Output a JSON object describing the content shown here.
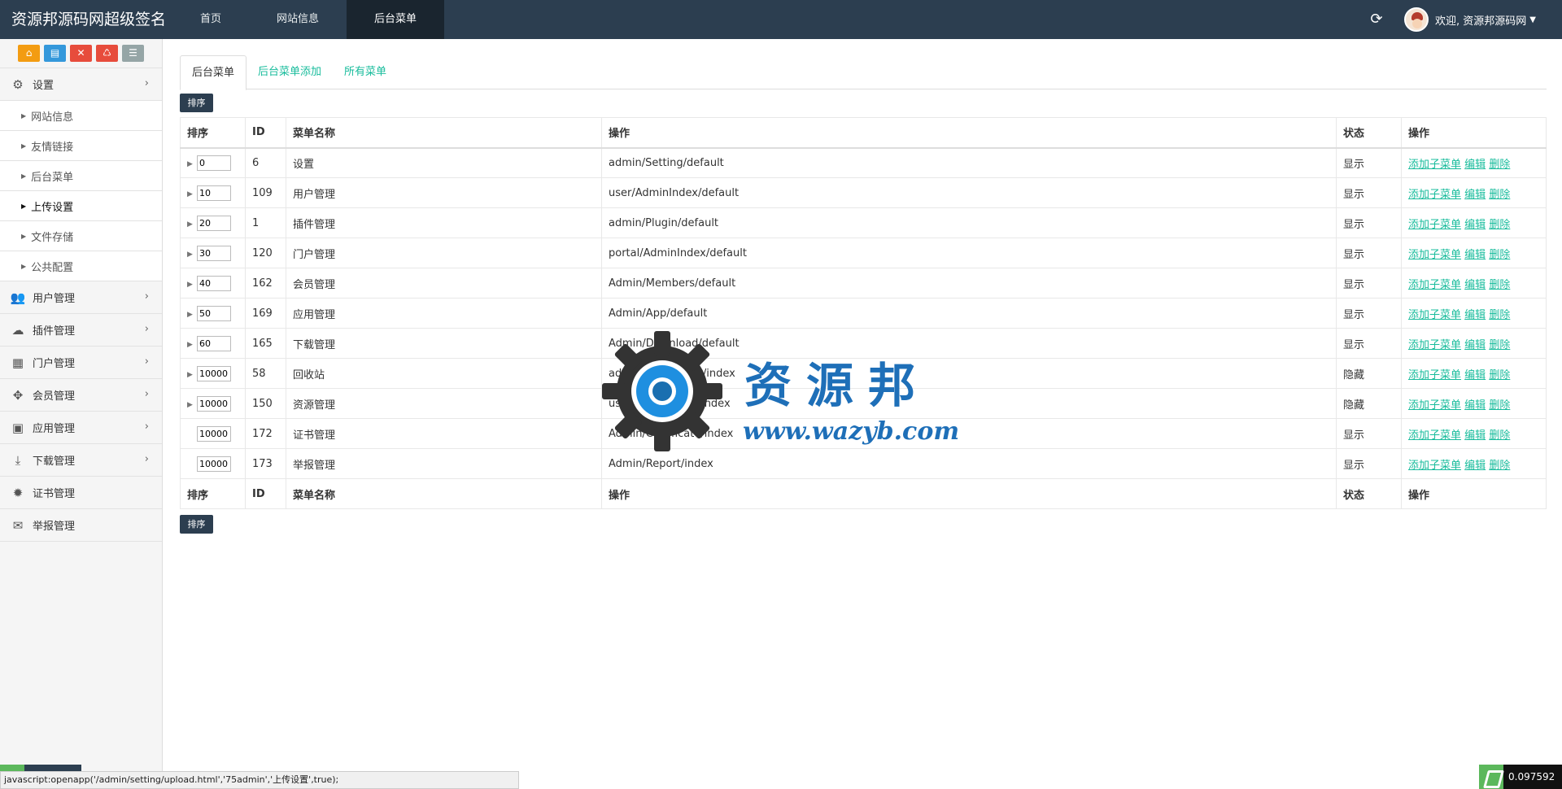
{
  "brand": "资源邦源码网超级签名",
  "nav": [
    "首页",
    "网站信息",
    "后台菜单"
  ],
  "user": {
    "greeting": "欢迎, 资源邦源码网"
  },
  "sidebar": {
    "settings_group": "设置",
    "settings_items": [
      "网站信息",
      "友情链接",
      "后台菜单",
      "上传设置",
      "文件存储",
      "公共配置"
    ],
    "groups": [
      {
        "label": "用户管理",
        "icon": "users-icon"
      },
      {
        "label": "插件管理",
        "icon": "cloud-icon"
      },
      {
        "label": "门户管理",
        "icon": "grid-icon"
      },
      {
        "label": "会员管理",
        "icon": "move-icon"
      },
      {
        "label": "应用管理",
        "icon": "android-icon"
      },
      {
        "label": "下载管理",
        "icon": "download-icon"
      },
      {
        "label": "证书管理",
        "icon": "cog-icon"
      },
      {
        "label": "举报管理",
        "icon": "envelope-icon"
      }
    ]
  },
  "tabs": [
    "后台菜单",
    "后台菜单添加",
    "所有菜单"
  ],
  "sort_button": "排序",
  "table": {
    "headers": [
      "排序",
      "ID",
      "菜单名称",
      "操作",
      "状态",
      "操作"
    ],
    "rows": [
      {
        "sort": "0",
        "id": "6",
        "name": "设置",
        "path": "admin/Setting/default",
        "status": "显示"
      },
      {
        "sort": "10",
        "id": "109",
        "name": "用户管理",
        "path": "user/AdminIndex/default",
        "status": "显示"
      },
      {
        "sort": "20",
        "id": "1",
        "name": "插件管理",
        "path": "admin/Plugin/default",
        "status": "显示"
      },
      {
        "sort": "30",
        "id": "120",
        "name": "门户管理",
        "path": "portal/AdminIndex/default",
        "status": "显示"
      },
      {
        "sort": "40",
        "id": "162",
        "name": "会员管理",
        "path": "Admin/Members/default",
        "status": "显示"
      },
      {
        "sort": "50",
        "id": "169",
        "name": "应用管理",
        "path": "Admin/App/default",
        "status": "显示"
      },
      {
        "sort": "60",
        "id": "165",
        "name": "下载管理",
        "path": "Admin/Download/default",
        "status": "显示"
      },
      {
        "sort": "10000",
        "id": "58",
        "name": "回收站",
        "path": "admin/RecycleBin/index",
        "status": "隐藏"
      },
      {
        "sort": "10000",
        "id": "150",
        "name": "资源管理",
        "path": "user/AdminAsset/index",
        "status": "隐藏"
      },
      {
        "sort": "10000",
        "id": "172",
        "name": "证书管理",
        "path": "Admin/Certificate/index",
        "status": "显示"
      },
      {
        "sort": "10000",
        "id": "173",
        "name": "举报管理",
        "path": "Admin/Report/index",
        "status": "显示"
      }
    ],
    "actions": [
      "添加子菜单",
      "编辑",
      "删除"
    ]
  },
  "watermark": {
    "cn": "资源邦",
    "url": "www.wazyb.com"
  },
  "statusbar": "javascript:openapp('/admin/setting/upload.html','75admin','上传设置',true);",
  "speed": "0.097592",
  "colors": {
    "navbar": "#2c3e50",
    "accent": "#18bc9c",
    "watermark": "#1e6fb8"
  }
}
